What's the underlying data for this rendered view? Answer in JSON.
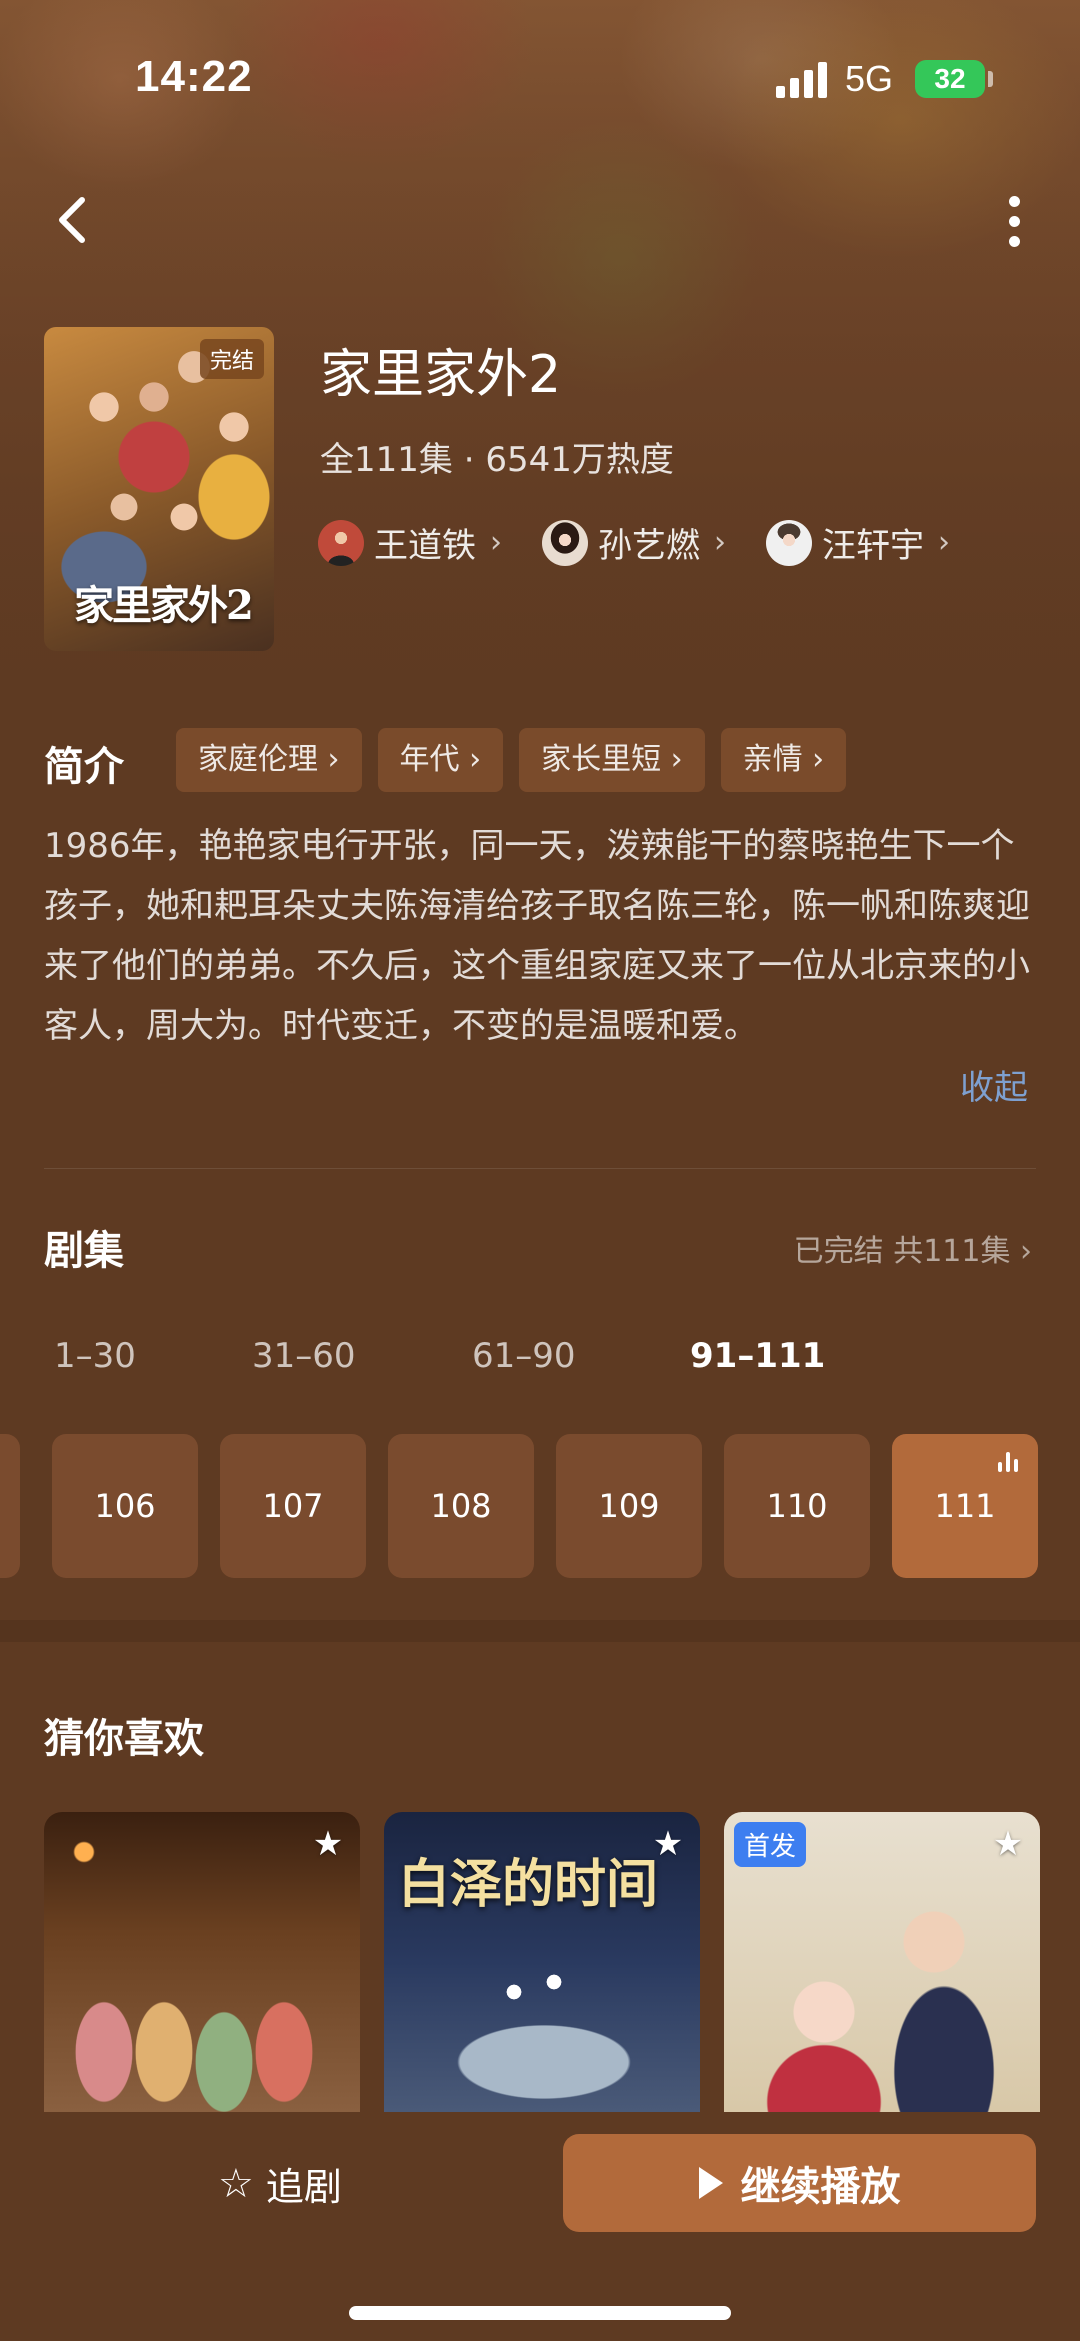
{
  "status_bar": {
    "time": "14:22",
    "network": "5G",
    "battery": "32"
  },
  "show": {
    "poster_badge": "完结",
    "poster_title": "家里家外2",
    "title": "家里家外2",
    "meta": "全111集 · 6541万热度",
    "cast": [
      {
        "name": "王道铁"
      },
      {
        "name": "孙艺燃"
      },
      {
        "name": "汪轩宇"
      }
    ]
  },
  "synopsis": {
    "heading": "简介",
    "tags": [
      "家庭伦理",
      "年代",
      "家长里短",
      "亲情"
    ],
    "text": "1986年，艳艳家电行开张，同一天，泼辣能干的蔡晓艳生下一个孩子，她和耙耳朵丈夫陈海清给孩子取名陈三轮，陈一帆和陈爽迎来了他们的弟弟。不久后，这个重组家庭又来了一位从北京来的小客人，周大为。时代变迁，不变的是温暖和爱。",
    "collapse_label": "收起"
  },
  "episodes": {
    "heading": "剧集",
    "status": "已完结 共111集",
    "ranges": [
      "1–30",
      "31–60",
      "61–90",
      "91–111"
    ],
    "active_range": "91–111",
    "items": [
      "106",
      "107",
      "108",
      "109",
      "110",
      "111"
    ],
    "current": "111"
  },
  "recommendations": {
    "heading": "猜你喜欢",
    "items": [
      {
        "badge": "",
        "title": ""
      },
      {
        "badge": "",
        "title": "白泽的时间"
      },
      {
        "badge": "首发",
        "title": ""
      }
    ]
  },
  "actions": {
    "follow_label": "追剧",
    "play_label": "继续播放"
  },
  "colors": {
    "background": "#5e3a22",
    "accent": "#b26a3b",
    "chip": "#7a4b2b",
    "link": "#7ea0d0",
    "battery": "#34c759",
    "first_badge": "#3d7ef0"
  }
}
